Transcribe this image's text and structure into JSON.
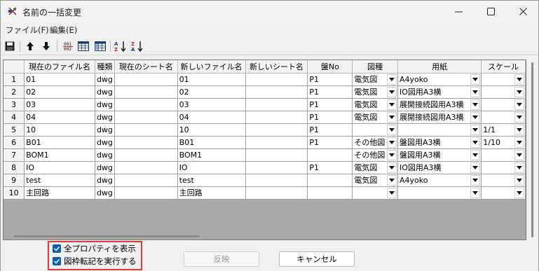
{
  "window": {
    "title": "名前の一括変更",
    "min_glyph": "—",
    "max_glyph": "☐",
    "close_glyph": "✕"
  },
  "menu": {
    "file": "ファイル(F)",
    "edit": "編集(E)"
  },
  "toolbar": {
    "icons": [
      "save-icon",
      "arrow-up-icon",
      "arrow-down-icon",
      "renumber-icon",
      "grid-icon",
      "grid-alt-icon",
      "sort-ascending-icon",
      "sort-descending-icon"
    ]
  },
  "table": {
    "headers": [
      "",
      "現在のファイル名",
      "種類",
      "現在のシート名",
      "新しいファイル名",
      "新しいシート名",
      "盤No",
      "図種",
      "用紙",
      "スケール"
    ],
    "rows": [
      {
        "no": "1",
        "cur_file": "01",
        "type": "dwg",
        "cur_sheet": "",
        "new_file": "01",
        "new_sheet": "",
        "ban": "P1",
        "zushu": "電気図",
        "youshi": "A4yoko",
        "scale": ""
      },
      {
        "no": "2",
        "cur_file": "02",
        "type": "dwg",
        "cur_sheet": "",
        "new_file": "02",
        "new_sheet": "",
        "ban": "P1",
        "zushu": "電気図",
        "youshi": "IO図用A3横",
        "scale": ""
      },
      {
        "no": "3",
        "cur_file": "03",
        "type": "dwg",
        "cur_sheet": "",
        "new_file": "03",
        "new_sheet": "",
        "ban": "P1",
        "zushu": "電気図",
        "youshi": "展開接続図用A3横",
        "scale": ""
      },
      {
        "no": "4",
        "cur_file": "04",
        "type": "dwg",
        "cur_sheet": "",
        "new_file": "04",
        "new_sheet": "",
        "ban": "P1",
        "zushu": "電気図",
        "youshi": "展開接続図用A3横",
        "scale": ""
      },
      {
        "no": "5",
        "cur_file": "10",
        "type": "dwg",
        "cur_sheet": "",
        "new_file": "10",
        "new_sheet": "",
        "ban": "P1",
        "zushu": "",
        "youshi": "",
        "scale": "1/1"
      },
      {
        "no": "6",
        "cur_file": "B01",
        "type": "dwg",
        "cur_sheet": "",
        "new_file": "B01",
        "new_sheet": "",
        "ban": "P1",
        "zushu": "その他図",
        "youshi": "盤図用A3横",
        "scale": "1/10"
      },
      {
        "no": "7",
        "cur_file": "BOM1",
        "type": "dwg",
        "cur_sheet": "",
        "new_file": "BOM1",
        "new_sheet": "",
        "ban": "",
        "zushu": "その他図",
        "youshi": "盤図用A3横",
        "scale": ""
      },
      {
        "no": "8",
        "cur_file": "IO",
        "type": "dwg",
        "cur_sheet": "",
        "new_file": "IO",
        "new_sheet": "",
        "ban": "P1",
        "zushu": "電気図",
        "youshi": "IO図用A3横",
        "scale": ""
      },
      {
        "no": "9",
        "cur_file": "test",
        "type": "dwg",
        "cur_sheet": "",
        "new_file": "test",
        "new_sheet": "",
        "ban": "",
        "zushu": "電気図",
        "youshi": "A4yoko",
        "scale": ""
      },
      {
        "no": "10",
        "cur_file": "主回路",
        "type": "dwg",
        "cur_sheet": "",
        "new_file": "主回路",
        "new_sheet": "",
        "ban": "",
        "zushu": "",
        "youshi": "",
        "scale": ""
      }
    ]
  },
  "footer": {
    "show_all_props": "全プロパティを表示",
    "run_title_block": "図枠転記を実行する",
    "apply_button": "反映",
    "cancel_button": "キャンセル"
  }
}
